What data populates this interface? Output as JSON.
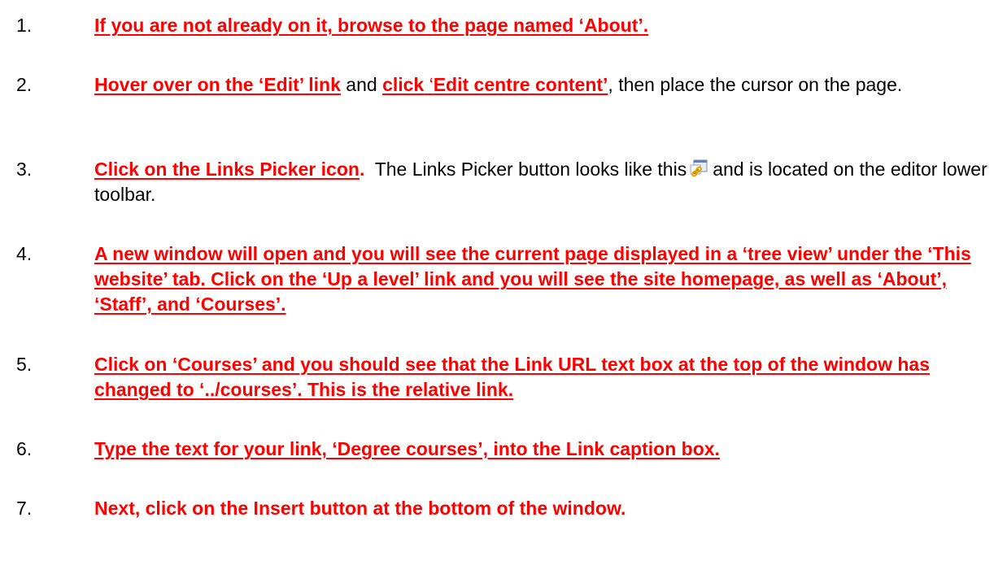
{
  "steps": [
    {
      "number": "1.",
      "parts": {
        "a": "If you are not already on it, browse to the page named ‘About’."
      }
    },
    {
      "number": "2.",
      "parts": {
        "a": "Hover over on the ‘Edit’ link",
        "b": " and ",
        "c": "click",
        "d": " ‘",
        "e": "Edit centre content’",
        "f": ", then place the cursor on the page."
      }
    },
    {
      "number": "3.",
      "parts": {
        "a": "Click on the Links Picker icon",
        "b": ".",
        "c": "  The Links Picker button looks like this",
        "d": "and is located on the editor lower toolbar."
      },
      "icon": "links-picker-icon"
    },
    {
      "number": "4.",
      "parts": {
        "a": "A new window will open and you will see the current page displayed in a ‘tree view’ under the ‘This website’ tab.  Click on the ‘Up a level’ link and you will see the site homepage, as well as ‘About’, ‘Staff’, and ‘Courses’."
      }
    },
    {
      "number": "5.",
      "parts": {
        "a": "Click on ‘Courses’ and you should see that the Link URL text box at the top of the window has changed to ‘../courses’.  This is the relative link."
      }
    },
    {
      "number": "6.",
      "parts": {
        "a": "Type the text for your link, ‘Degree courses’, into the Link caption box."
      }
    },
    {
      "number": "7.",
      "parts": {
        "a": "Next, click on the Insert button at the bottom of the window."
      }
    }
  ],
  "colors": {
    "instruction": "#ff0000",
    "body": "#000000"
  }
}
